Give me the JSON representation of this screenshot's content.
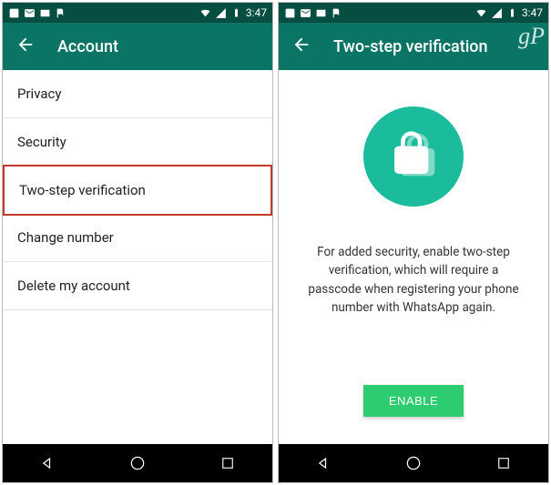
{
  "status": {
    "time": "3:47"
  },
  "left": {
    "title": "Account",
    "items": [
      {
        "label": "Privacy"
      },
      {
        "label": "Security"
      },
      {
        "label": "Two-step verification",
        "highlighted": true
      },
      {
        "label": "Change number"
      },
      {
        "label": "Delete my account"
      }
    ]
  },
  "right": {
    "title": "Two-step verification",
    "description": "For added security, enable two-step verification, which will require a passcode when registering your phone number with WhatsApp again.",
    "button": "ENABLE",
    "watermark": "gP"
  }
}
